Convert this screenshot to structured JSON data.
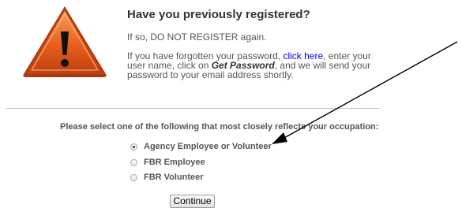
{
  "notice": {
    "heading": "Have you previously registered?",
    "line1": "If so, DO NOT REGISTER again.",
    "para_before_link": "If you have forgotten your password, ",
    "link_text": "click here",
    "para_mid": ", enter your user name, click on ",
    "para_emphasis": "Get Password",
    "para_after": ", and we will send your password to your email address shortly."
  },
  "form": {
    "question": "Please select one of the following that most closely reflects your occupation:",
    "options": [
      {
        "label": "Agency Employee or Volunteer",
        "selected": true
      },
      {
        "label": "FBR Employee",
        "selected": false
      },
      {
        "label": "FBR Volunteer",
        "selected": false
      }
    ],
    "continue_label": "Continue"
  },
  "icons": {
    "warning": "warning-triangle-icon",
    "annotation": "arrow-annotation"
  },
  "colors": {
    "warning_orange": "#e8601c",
    "link": "#0000ee",
    "arrow": "#000000"
  }
}
